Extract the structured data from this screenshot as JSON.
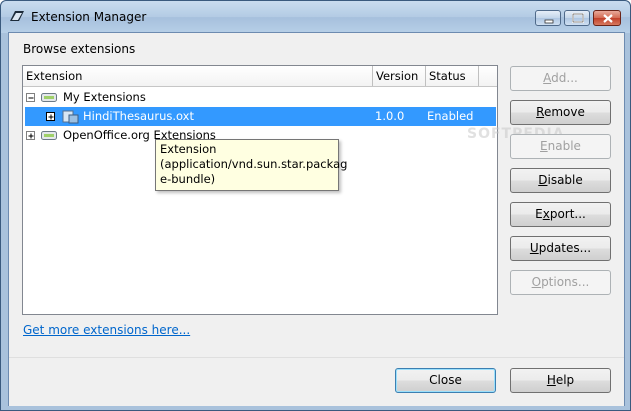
{
  "window": {
    "title": "Extension Manager"
  },
  "titlebar_buttons": {
    "minimize": "minimize",
    "maximize": "maximize",
    "close": "close"
  },
  "section_label": "Browse extensions",
  "columns": [
    "Extension",
    "Version",
    "Status"
  ],
  "tree": [
    {
      "label": "My Extensions",
      "version": "",
      "status": "",
      "level": 0,
      "expander": "minus",
      "icon": "folder-drawer-icon"
    },
    {
      "label": "HindiThesaurus.oxt",
      "version": "1.0.0",
      "status": "Enabled",
      "level": 1,
      "expander": "plus",
      "icon": "extension-icon",
      "selected": true
    },
    {
      "label": "OpenOffice.org Extensions",
      "version": "",
      "status": "",
      "level": 0,
      "expander": "plus",
      "icon": "folder-drawer-icon"
    }
  ],
  "tooltip": [
    "Extension",
    "(application/vnd.sun.star.packag",
    "e-bundle)"
  ],
  "buttons": {
    "add": {
      "label": "Add...",
      "mnemonic": "A",
      "enabled": false
    },
    "remove": {
      "label": "Remove",
      "mnemonic": "R",
      "enabled": true
    },
    "enable": {
      "label": "Enable",
      "mnemonic": "E",
      "enabled": false
    },
    "disable": {
      "label": "Disable",
      "mnemonic": "D",
      "enabled": true
    },
    "export": {
      "label": "Export...",
      "mnemonic": "x",
      "enabled": true
    },
    "updates": {
      "label": "Updates...",
      "mnemonic": "U",
      "enabled": true
    },
    "options": {
      "label": "Options...",
      "mnemonic": "O",
      "enabled": false
    }
  },
  "link": "Get more extensions here...",
  "footer": {
    "close": "Close",
    "help": "Help"
  },
  "watermark": "SOFTPEDIA"
}
